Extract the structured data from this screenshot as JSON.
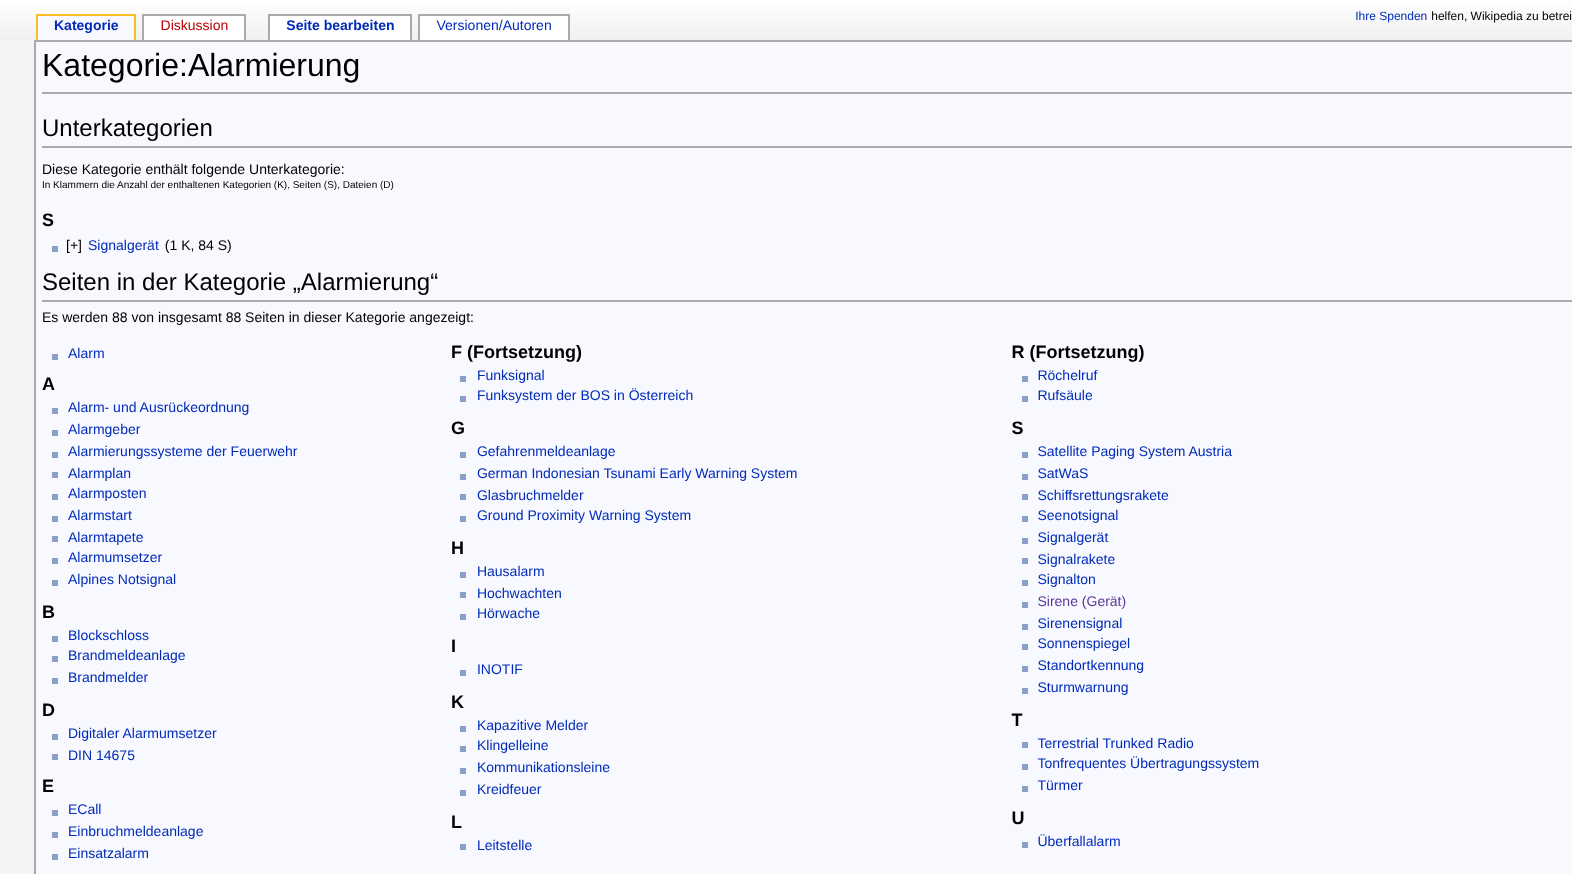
{
  "tabs": [
    {
      "label": "Kategorie",
      "selected": true,
      "missing": false
    },
    {
      "label": "Diskussion",
      "selected": false,
      "missing": true
    },
    {
      "label": "Seite bearbeiten",
      "selected": false,
      "missing": false
    },
    {
      "label": "Versionen/Autoren",
      "selected": false,
      "missing": false
    }
  ],
  "notice": {
    "link": "Ihre Spenden",
    "text": "helfen, Wikipedia zu betrei"
  },
  "title": "Kategorie:Alarmierung",
  "subcategories": {
    "heading": "Unterkategorien",
    "intro": "Diese Kategorie enthält folgende Unterkategorie:",
    "note": "In Klammern die Anzahl der enthaltenen Kategorien (K), Seiten (S), Dateien (D)",
    "letter": "S",
    "items": [
      {
        "toggle": "[+]",
        "link": "Signalgerät",
        "count": "(1 K, 84 S)"
      }
    ]
  },
  "pages": {
    "heading": "Seiten in der Kategorie „Alarmierung“",
    "intro": "Es werden 88 von insgesamt 88 Seiten in dieser Kategorie angezeigt:",
    "columns": [
      {
        "sections": [
          {
            "items": [
              {
                "text": "Alarm",
                "visited": false
              }
            ]
          },
          {
            "heading": "A",
            "items": [
              {
                "text": "Alarm- und Ausrückeordnung",
                "visited": false
              },
              {
                "text": "Alarmgeber",
                "visited": false
              },
              {
                "text": "Alarmierungssysteme der Feuerwehr",
                "visited": false
              },
              {
                "text": "Alarmplan",
                "visited": false
              },
              {
                "text": "Alarmposten",
                "visited": false
              },
              {
                "text": "Alarmstart",
                "visited": false
              },
              {
                "text": "Alarmtapete",
                "visited": false
              },
              {
                "text": "Alarmumsetzer",
                "visited": false
              },
              {
                "text": "Alpines Notsignal",
                "visited": false
              }
            ]
          },
          {
            "heading": "B",
            "items": [
              {
                "text": "Blockschloss",
                "visited": false
              },
              {
                "text": "Brandmeldeanlage",
                "visited": false
              },
              {
                "text": "Brandmelder",
                "visited": false
              }
            ]
          },
          {
            "heading": "D",
            "items": [
              {
                "text": "Digitaler Alarmumsetzer",
                "visited": false
              },
              {
                "text": "DIN 14675",
                "visited": false
              }
            ]
          },
          {
            "heading": "E",
            "items": [
              {
                "text": "ECall",
                "visited": false
              },
              {
                "text": "Einbruchmeldeanlage",
                "visited": false
              },
              {
                "text": "Einsatzalarm",
                "visited": false
              }
            ]
          }
        ]
      },
      {
        "sections": [
          {
            "heading": "F (Fortsetzung)",
            "items": [
              {
                "text": "Funksignal",
                "visited": false
              },
              {
                "text": "Funksystem der BOS in Österreich",
                "visited": false
              }
            ]
          },
          {
            "heading": "G",
            "items": [
              {
                "text": "Gefahrenmeldeanlage",
                "visited": false
              },
              {
                "text": "German Indonesian Tsunami Early Warning System",
                "visited": false
              },
              {
                "text": "Glasbruchmelder",
                "visited": false
              },
              {
                "text": "Ground Proximity Warning System",
                "visited": false
              }
            ]
          },
          {
            "heading": "H",
            "items": [
              {
                "text": "Hausalarm",
                "visited": false
              },
              {
                "text": "Hochwachten",
                "visited": false
              },
              {
                "text": "Hörwache",
                "visited": false
              }
            ]
          },
          {
            "heading": "I",
            "items": [
              {
                "text": "INOTIF",
                "visited": false
              }
            ]
          },
          {
            "heading": "K",
            "items": [
              {
                "text": "Kapazitive Melder",
                "visited": false
              },
              {
                "text": "Klingelleine",
                "visited": false
              },
              {
                "text": "Kommunikationsleine",
                "visited": false
              },
              {
                "text": "Kreidfeuer",
                "visited": false
              }
            ]
          },
          {
            "heading": "L",
            "items": [
              {
                "text": "Leitstelle",
                "visited": false
              }
            ]
          }
        ]
      },
      {
        "sections": [
          {
            "heading": "R (Fortsetzung)",
            "items": [
              {
                "text": "Röchelruf",
                "visited": false
              },
              {
                "text": "Rufsäule",
                "visited": false
              }
            ]
          },
          {
            "heading": "S",
            "items": [
              {
                "text": "Satellite Paging System Austria",
                "visited": false
              },
              {
                "text": "SatWaS",
                "visited": false
              },
              {
                "text": "Schiffsrettungsrakete",
                "visited": false
              },
              {
                "text": "Seenotsignal",
                "visited": false
              },
              {
                "text": "Signalgerät",
                "visited": false
              },
              {
                "text": "Signalrakete",
                "visited": false
              },
              {
                "text": "Signalton",
                "visited": false
              },
              {
                "text": "Sirene (Gerät)",
                "visited": true
              },
              {
                "text": "Sirenensignal",
                "visited": false
              },
              {
                "text": "Sonnenspiegel",
                "visited": false
              },
              {
                "text": "Standortkennung",
                "visited": false
              },
              {
                "text": "Sturmwarnung",
                "visited": false
              }
            ]
          },
          {
            "heading": "T",
            "items": [
              {
                "text": "Terrestrial Trunked Radio",
                "visited": false
              },
              {
                "text": "Tonfrequentes Übertragungssystem",
                "visited": false
              },
              {
                "text": "Türmer",
                "visited": false
              }
            ]
          },
          {
            "heading": "U",
            "items": [
              {
                "text": "Überfallalarm",
                "visited": false
              }
            ]
          }
        ]
      }
    ]
  }
}
